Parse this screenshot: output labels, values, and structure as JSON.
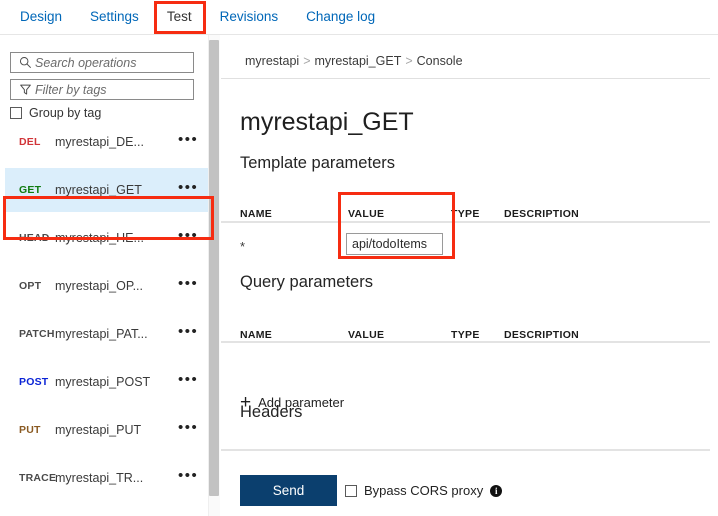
{
  "tabs": [
    {
      "label": "Design",
      "active": false
    },
    {
      "label": "Settings",
      "active": false
    },
    {
      "label": "Test",
      "active": true
    },
    {
      "label": "Revisions",
      "active": false
    },
    {
      "label": "Change log",
      "active": false
    }
  ],
  "sidebar": {
    "search": {
      "placeholder": "Search operations",
      "value": "",
      "icon": "search-icon"
    },
    "filter": {
      "placeholder": "Filter by tags",
      "value": "",
      "icon": "filter-icon"
    },
    "group_by_tag": {
      "label": "Group by tag",
      "checked": false
    },
    "operations": [
      {
        "verb": "DEL",
        "verb_color": "#d13438",
        "name": "myrestapi_DE...",
        "selected": false,
        "menu": "•••"
      },
      {
        "verb": "GET",
        "verb_color": "#107c10",
        "name": "myrestapi_GET",
        "selected": true,
        "menu": "•••"
      },
      {
        "verb": "HEAD",
        "verb_color": "#4a4a4a",
        "name": "myrestapi_HE...",
        "selected": false,
        "menu": "•••"
      },
      {
        "verb": "OPT",
        "verb_color": "#4a4a4a",
        "name": "myrestapi_OP...",
        "selected": false,
        "menu": "•••"
      },
      {
        "verb": "PATCH",
        "verb_color": "#4a4a4a",
        "name": "myrestapi_PAT...",
        "selected": false,
        "menu": "•••"
      },
      {
        "verb": "POST",
        "verb_color": "#0b24d6",
        "name": "myrestapi_POST",
        "selected": false,
        "menu": "•••"
      },
      {
        "verb": "PUT",
        "verb_color": "#8a5a22",
        "name": "myrestapi_PUT",
        "selected": false,
        "menu": "•••"
      },
      {
        "verb": "TRACE",
        "verb_color": "#4a4a4a",
        "name": "myrestapi_TR...",
        "selected": false,
        "menu": "•••"
      }
    ]
  },
  "main": {
    "breadcrumb": {
      "root": "myrestapi",
      "sep1": ">",
      "operation": "myrestapi_GET",
      "sep2": ">",
      "leaf": "Console"
    },
    "title": "myrestapi_GET",
    "template_parameters": {
      "heading": "Template parameters",
      "columns": {
        "name": "NAME",
        "value": "VALUE",
        "type": "TYPE",
        "description": "DESCRIPTION"
      },
      "rows": [
        {
          "name": "*",
          "value": "api/todoItems",
          "type": "",
          "description": ""
        }
      ]
    },
    "query_parameters": {
      "heading": "Query parameters",
      "columns": {
        "name": "NAME",
        "value": "VALUE",
        "type": "TYPE",
        "description": "DESCRIPTION"
      },
      "add_label": "Add parameter",
      "add_icon": "plus-icon"
    },
    "headers": {
      "heading": "Headers"
    },
    "footer": {
      "send_label": "Send",
      "bypass_label": "Bypass CORS proxy",
      "bypass_checked": false,
      "info_icon": "info-icon",
      "info_glyph": "i"
    }
  },
  "highlights": {
    "test_tab": "#f62c11",
    "get_row": "#f62c11",
    "value_cell": "#f62c11"
  },
  "colors": {
    "link": "#0067b8",
    "selected_row_bg": "#dbeefb",
    "send_button_bg": "#0b3f6e",
    "highlight_red": "#f62c11"
  }
}
